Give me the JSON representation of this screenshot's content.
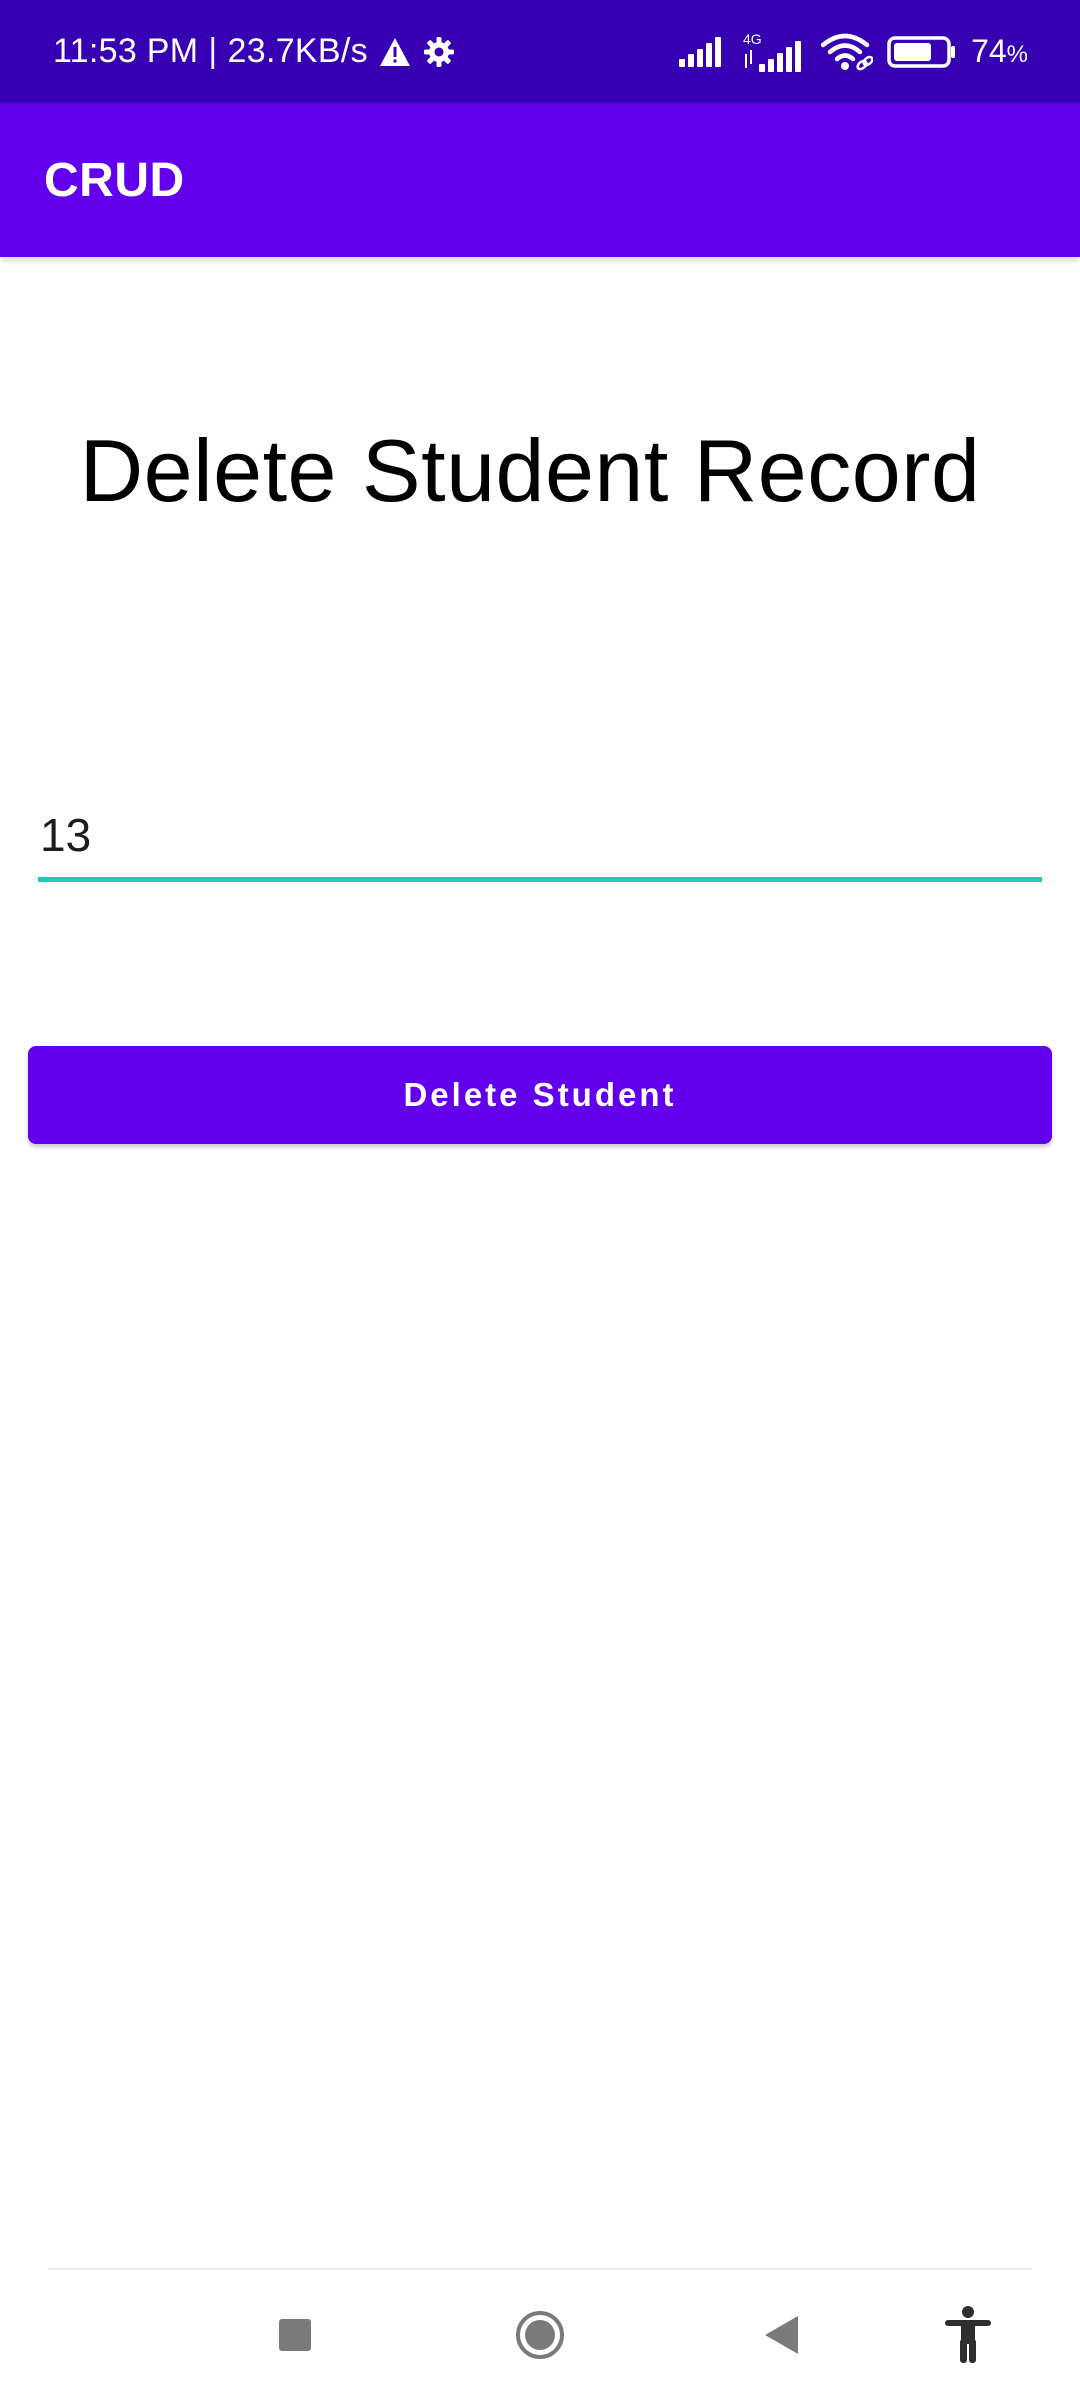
{
  "status_bar": {
    "time": "11:53 PM",
    "separator": "|",
    "network_speed": "23.7KB/s",
    "network_type": "4G",
    "battery_percent": "74",
    "battery_unit": "%",
    "battery_level": 0.74,
    "icons": [
      "warning-icon",
      "settings-gear-icon",
      "signal-icon",
      "signal-4g-icon",
      "wifi-icon",
      "battery-icon"
    ]
  },
  "app_bar": {
    "title": "CRUD"
  },
  "form": {
    "heading": "Delete Student Record",
    "id_input_value": "13",
    "delete_button_label": "Delete Student"
  },
  "nav_bar": {
    "icons": [
      "recent-apps-icon",
      "home-icon",
      "back-icon",
      "accessibility-icon"
    ]
  },
  "colors": {
    "status_bar": "#3700b3",
    "primary": "#6200ee",
    "input_underline": "#26c6b8",
    "nav_icon": "#7a7a7a"
  }
}
